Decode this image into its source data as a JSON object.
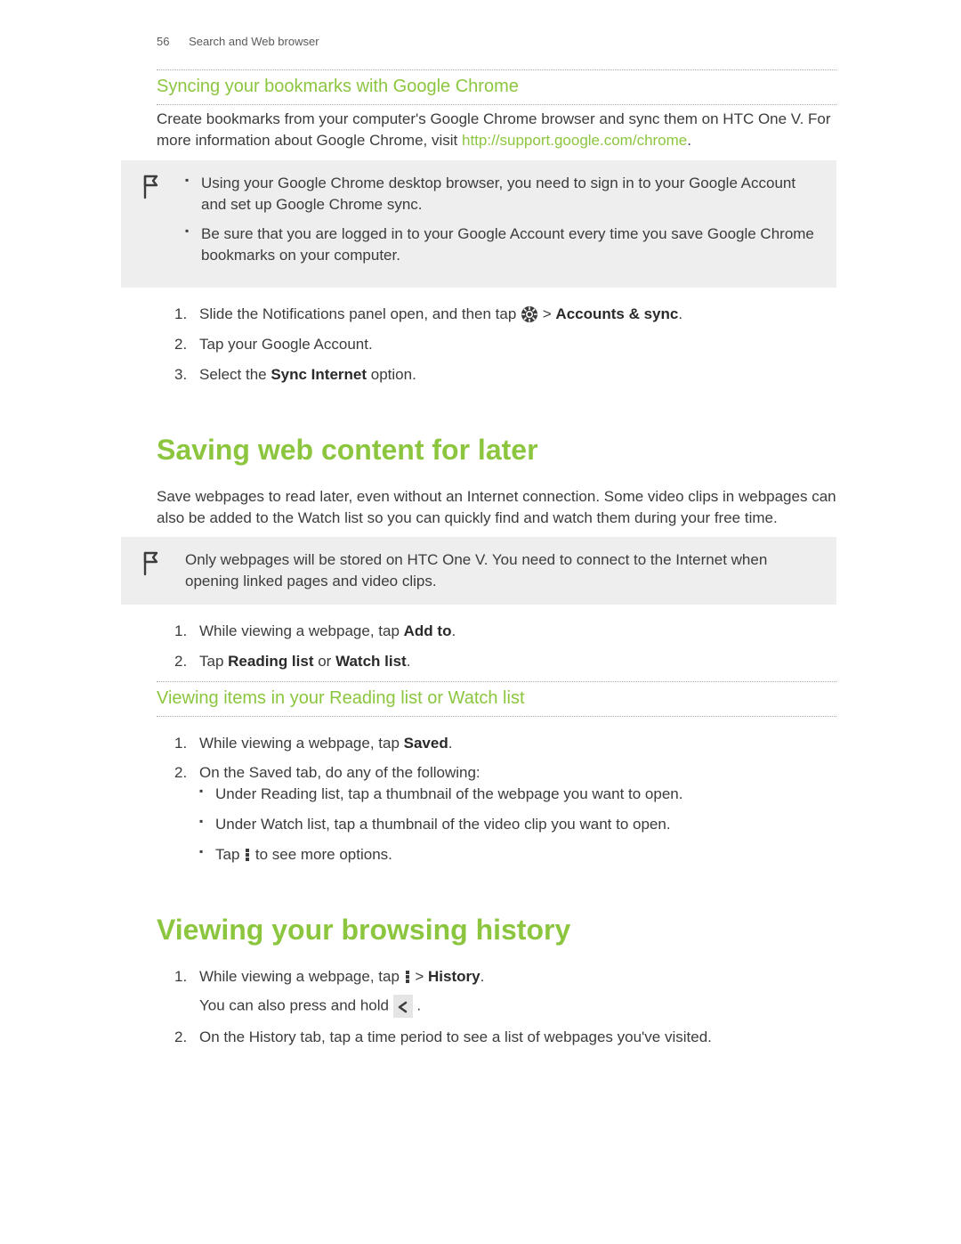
{
  "header": {
    "page_number": "56",
    "section": "Search and Web browser"
  },
  "sec1": {
    "title": "Syncing your bookmarks with Google Chrome",
    "intro_pre": "Create bookmarks from your computer's Google Chrome browser and sync them on HTC One V. For more information about Google Chrome, visit ",
    "intro_link": "http://support.google.com/chrome",
    "intro_post": ".",
    "callout_b1": "Using your Google Chrome desktop browser, you need to sign in to your Google Account and set up Google Chrome sync.",
    "callout_b2": "Be sure that you are logged in to your Google Account every time you save Google Chrome bookmarks on your computer.",
    "step1_pre": "Slide the Notifications panel open, and then tap ",
    "step1_mid": " > ",
    "step1_bold": "Accounts & sync",
    "step1_post": ".",
    "step2": "Tap your Google Account.",
    "step3_pre": "Select the ",
    "step3_bold": "Sync Internet",
    "step3_post": " option."
  },
  "sec2": {
    "title": "Saving web content for later",
    "intro": "Save webpages to read later, even without an Internet connection. Some video clips in webpages can also be added to the Watch list so you can quickly find and watch them during your free time.",
    "callout": "Only webpages will be stored on HTC One V. You need to connect to the Internet when opening linked pages and video clips.",
    "step1_pre": "While viewing a webpage, tap ",
    "step1_bold": "Add to",
    "step1_post": ".",
    "step2_pre": "Tap ",
    "step2_bold1": "Reading list",
    "step2_mid": " or ",
    "step2_bold2": "Watch list",
    "step2_post": ".",
    "sub_title": "Viewing items in your Reading list or Watch list",
    "vstep1_pre": "While viewing a webpage, tap ",
    "vstep1_bold": "Saved",
    "vstep1_post": ".",
    "vstep2": "On the Saved tab, do any of the following:",
    "vb1": "Under Reading list, tap a thumbnail of the webpage you want to open.",
    "vb2": "Under Watch list, tap a thumbnail of the video clip you want to open.",
    "vb3_pre": "Tap ",
    "vb3_post": " to see more options."
  },
  "sec3": {
    "title": "Viewing your browsing history",
    "step1_pre": "While viewing a webpage, tap ",
    "step1_mid": " > ",
    "step1_bold": "History",
    "step1_post": ".",
    "step1_sub_pre": "You can also press and hold ",
    "step1_sub_post": " .",
    "step2": "On the History tab, tap a time period to see a list of webpages you've visited."
  }
}
